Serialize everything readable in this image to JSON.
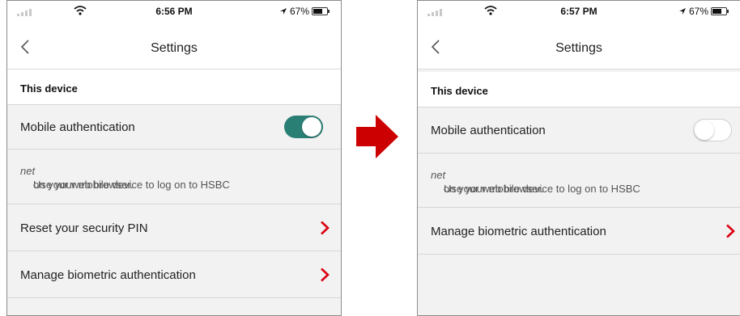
{
  "colors": {
    "accent_red": "#db0011",
    "toggle_on": "#2a7f74"
  },
  "left_screen": {
    "status": {
      "time": "6:56 PM",
      "battery": "67%",
      "battery_level": 0.67
    },
    "nav": {
      "title": "Settings",
      "back_icon": "chevron-left-icon"
    },
    "section_title": "This device",
    "mobile_auth": {
      "label": "Mobile authentication",
      "enabled": true
    },
    "description_pre": "Use your mobile device to log on to HSBC",
    "description_brand": "net",
    "description_post": " on your web browser.",
    "items": [
      {
        "label": "Reset your security PIN",
        "icon": "chevron-right-icon"
      },
      {
        "label": "Manage biometric authentication",
        "icon": "chevron-right-icon"
      }
    ]
  },
  "right_screen": {
    "status": {
      "time": "6:57 PM",
      "battery": "67%",
      "battery_level": 0.67
    },
    "nav": {
      "title": "Settings",
      "back_icon": "chevron-left-icon"
    },
    "section_title": "This device",
    "mobile_auth": {
      "label": "Mobile authentication",
      "enabled": false
    },
    "description_pre": "Use your mobile device to log on to HSBC",
    "description_brand": "net",
    "description_post": " on your web browser.",
    "items": [
      {
        "label": "Manage biometric authentication",
        "icon": "chevron-right-icon"
      }
    ]
  },
  "transition_icon": "arrow-right-icon"
}
